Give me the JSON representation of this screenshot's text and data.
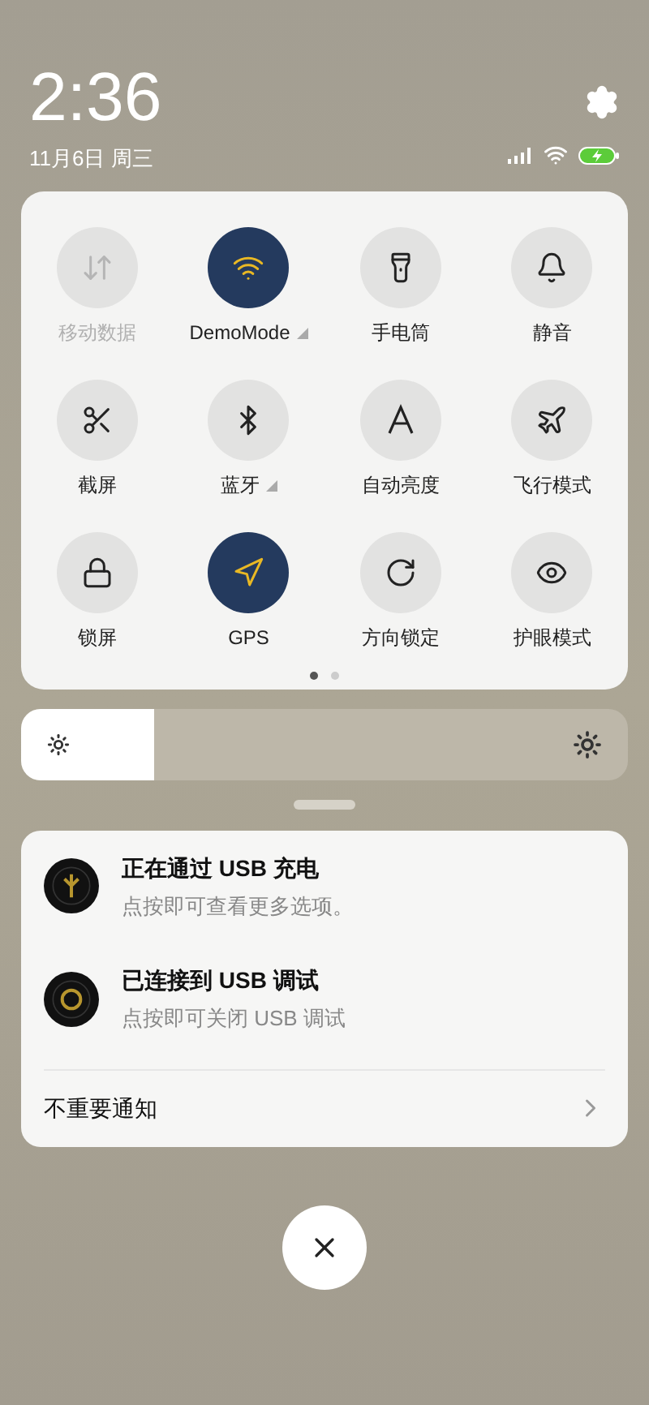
{
  "status": {
    "time": "2:36",
    "date": "11月6日 周三"
  },
  "tiles": [
    {
      "kind": "data",
      "label": "移动数据",
      "on": false,
      "disabled": true,
      "has_menu": false
    },
    {
      "kind": "wifi",
      "label": "DemoMode",
      "on": true,
      "disabled": false,
      "has_menu": true
    },
    {
      "kind": "flashlight",
      "label": "手电筒",
      "on": false,
      "disabled": false,
      "has_menu": false
    },
    {
      "kind": "bell",
      "label": "静音",
      "on": false,
      "disabled": false,
      "has_menu": false
    },
    {
      "kind": "screenshot",
      "label": "截屏",
      "on": false,
      "disabled": false,
      "has_menu": false
    },
    {
      "kind": "bluetooth",
      "label": "蓝牙",
      "on": false,
      "disabled": false,
      "has_menu": true
    },
    {
      "kind": "auto_brightness",
      "label": "自动亮度",
      "on": false,
      "disabled": false,
      "has_menu": false
    },
    {
      "kind": "airplane",
      "label": "飞行模式",
      "on": false,
      "disabled": false,
      "has_menu": false
    },
    {
      "kind": "lock",
      "label": "锁屏",
      "on": false,
      "disabled": false,
      "has_menu": false
    },
    {
      "kind": "gps",
      "label": "GPS",
      "on": true,
      "disabled": false,
      "has_menu": false
    },
    {
      "kind": "rotation_lock",
      "label": "方向锁定",
      "on": false,
      "disabled": false,
      "has_menu": false
    },
    {
      "kind": "eye",
      "label": "护眼模式",
      "on": false,
      "disabled": false,
      "has_menu": false
    }
  ],
  "pages": [
    {
      "selected": true
    },
    {
      "selected": false
    }
  ],
  "brightness": {
    "level": 0.22
  },
  "notifications": [
    {
      "kind": "charging",
      "title": "正在通过 USB 充电",
      "text": "点按即可查看更多选项。"
    },
    {
      "kind": "debug",
      "title": "已连接到 USB 调试",
      "text": "点按即可关闭 USB 调试"
    }
  ],
  "footer": {
    "label": "不重要通知"
  }
}
